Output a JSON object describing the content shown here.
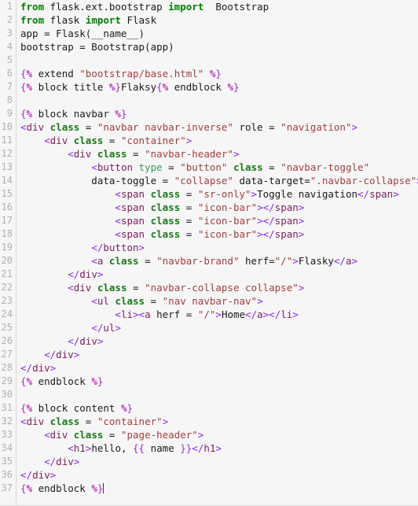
{
  "editor": {
    "background_color": "#f6f6f6",
    "gutter_color": "#b0b0b0",
    "total_lines": 37,
    "cursor_line": 37,
    "language": "Jinja2 / HTML / Python"
  },
  "colors": {
    "keyword": "#008000",
    "string": "#a14040",
    "tag_punct": "#8a2be2",
    "tag_name": "#7a1f5c",
    "attribute": "#1a7a1a",
    "jinja_brace": "#9b30c0",
    "jinja_percent": "#bb29bb",
    "plain_text": "#1a1a1a",
    "line_number": "#b0b0b0",
    "background": "#f6f6f6"
  },
  "gutter": {
    "numbers": [
      "1",
      "2",
      "3",
      "4",
      "5",
      "6",
      "7",
      "8",
      "9",
      "10",
      "11",
      "12",
      "13",
      "14",
      "15",
      "16",
      "17",
      "18",
      "19",
      "20",
      "21",
      "22",
      "23",
      "24",
      "25",
      "26",
      "27",
      "28",
      "29",
      "30",
      "31",
      "32",
      "33",
      "34",
      "35",
      "36",
      "37"
    ]
  },
  "lines": [
    {
      "n": 1,
      "text": "from flask.ext.bootstrap import  Bootstrap"
    },
    {
      "n": 2,
      "text": "from flask import Flask"
    },
    {
      "n": 3,
      "text": "app = Flask(__name__)"
    },
    {
      "n": 4,
      "text": "bootstrap = Bootstrap(app)"
    },
    {
      "n": 5,
      "text": ""
    },
    {
      "n": 6,
      "text": "{% extend \"bootstrap/base.html\" %}"
    },
    {
      "n": 7,
      "text": "{% block title %}Flaksy{% endblock %}"
    },
    {
      "n": 8,
      "text": ""
    },
    {
      "n": 9,
      "text": "{% block navbar %}"
    },
    {
      "n": 10,
      "text": "<div class = \"navbar navbar-inverse\" role = \"navigation\">"
    },
    {
      "n": 11,
      "text": "    <div class = \"container\">"
    },
    {
      "n": 12,
      "text": "        <div class = \"navbar-header\">"
    },
    {
      "n": 13,
      "text": "            <button type = \"button\" class = \"navbar-toggle\""
    },
    {
      "n": 14,
      "text": "            data-toggle = \"collapse\" data-target=\".navbar-collapse\">"
    },
    {
      "n": 15,
      "text": "                <span class = \"sr-only\">Toggle navigation</span>"
    },
    {
      "n": 16,
      "text": "                <span class = \"icon-bar\"></span>"
    },
    {
      "n": 17,
      "text": "                <span class = \"icon-bar\"></span>"
    },
    {
      "n": 18,
      "text": "                <span class = \"icon-bar\"></span>"
    },
    {
      "n": 19,
      "text": "            </button>"
    },
    {
      "n": 20,
      "text": "            <a class = \"navbar-brand\" herf=\"/\">Flasky</a>"
    },
    {
      "n": 21,
      "text": "        </div>"
    },
    {
      "n": 22,
      "text": "        <div class = \"navbar-collapse collapse\">"
    },
    {
      "n": 23,
      "text": "            <ul class = \"nav navbar-nav\">"
    },
    {
      "n": 24,
      "text": "                <li><a herf = \"/\">Home</a></li>"
    },
    {
      "n": 25,
      "text": "            </ul>"
    },
    {
      "n": 26,
      "text": "        </div>"
    },
    {
      "n": 27,
      "text": "    </div>"
    },
    {
      "n": 28,
      "text": "</div>"
    },
    {
      "n": 29,
      "text": "{% endblock %}"
    },
    {
      "n": 30,
      "text": ""
    },
    {
      "n": 31,
      "text": "{% block content %}"
    },
    {
      "n": 32,
      "text": "<div class = \"container\">"
    },
    {
      "n": 33,
      "text": "    <div class = \"page-header\">"
    },
    {
      "n": 34,
      "text": "        <h1>hello, {{ name }}</h1>"
    },
    {
      "n": 35,
      "text": "    </div>"
    },
    {
      "n": 36,
      "text": "</div>"
    },
    {
      "n": 37,
      "text": "{% endblock %}"
    }
  ],
  "tokens": [
    [
      {
        "t": "from",
        "c": "t-kw"
      },
      {
        "t": " flask.ext.bootstrap ",
        "c": "t-plain"
      },
      {
        "t": "import",
        "c": "t-kw"
      },
      {
        "t": "  Bootstrap",
        "c": "t-plain"
      }
    ],
    [
      {
        "t": "from",
        "c": "t-kw"
      },
      {
        "t": " flask ",
        "c": "t-plain"
      },
      {
        "t": "import",
        "c": "t-kw"
      },
      {
        "t": " Flask",
        "c": "t-plain"
      }
    ],
    [
      {
        "t": "app = Flask(__name__)",
        "c": "t-plain"
      }
    ],
    [
      {
        "t": "bootstrap = Bootstrap(app)",
        "c": "t-plain"
      }
    ],
    [],
    [
      {
        "t": "{",
        "c": "t-brace"
      },
      {
        "t": "%",
        "c": "t-pct"
      },
      {
        "t": " extend ",
        "c": "t-plain"
      },
      {
        "t": "\"bootstrap/base.html\"",
        "c": "t-str"
      },
      {
        "t": " ",
        "c": "t-plain"
      },
      {
        "t": "%",
        "c": "t-pct"
      },
      {
        "t": "}",
        "c": "t-brace"
      }
    ],
    [
      {
        "t": "{",
        "c": "t-brace"
      },
      {
        "t": "%",
        "c": "t-pct"
      },
      {
        "t": " block title ",
        "c": "t-plain"
      },
      {
        "t": "%",
        "c": "t-pct"
      },
      {
        "t": "}",
        "c": "t-brace"
      },
      {
        "t": "Flaksy",
        "c": "t-text"
      },
      {
        "t": "{",
        "c": "t-brace"
      },
      {
        "t": "%",
        "c": "t-pct"
      },
      {
        "t": " endblock ",
        "c": "t-plain"
      },
      {
        "t": "%",
        "c": "t-pct"
      },
      {
        "t": "}",
        "c": "t-brace"
      }
    ],
    [],
    [
      {
        "t": "{",
        "c": "t-brace"
      },
      {
        "t": "%",
        "c": "t-pct"
      },
      {
        "t": " block navbar ",
        "c": "t-plain"
      },
      {
        "t": "%",
        "c": "t-pct"
      },
      {
        "t": "}",
        "c": "t-brace"
      }
    ],
    [
      {
        "t": "<",
        "c": "t-punct"
      },
      {
        "t": "div",
        "c": "t-tag"
      },
      {
        "t": " ",
        "c": "t-plain"
      },
      {
        "t": "class",
        "c": "t-attr"
      },
      {
        "t": " = ",
        "c": "t-plain"
      },
      {
        "t": "\"navbar navbar-inverse\"",
        "c": "t-str"
      },
      {
        "t": " role = ",
        "c": "t-plain"
      },
      {
        "t": "\"navigation\"",
        "c": "t-str"
      },
      {
        "t": ">",
        "c": "t-punct"
      }
    ],
    [
      {
        "t": "    ",
        "c": "t-plain"
      },
      {
        "t": "<",
        "c": "t-punct"
      },
      {
        "t": "div",
        "c": "t-tag"
      },
      {
        "t": " ",
        "c": "t-plain"
      },
      {
        "t": "class",
        "c": "t-attr"
      },
      {
        "t": " = ",
        "c": "t-plain"
      },
      {
        "t": "\"container\"",
        "c": "t-str"
      },
      {
        "t": ">",
        "c": "t-punct"
      }
    ],
    [
      {
        "t": "        ",
        "c": "t-plain"
      },
      {
        "t": "<",
        "c": "t-punct"
      },
      {
        "t": "div",
        "c": "t-tag"
      },
      {
        "t": " ",
        "c": "t-plain"
      },
      {
        "t": "class",
        "c": "t-attr"
      },
      {
        "t": " = ",
        "c": "t-plain"
      },
      {
        "t": "\"navbar-header\"",
        "c": "t-str"
      },
      {
        "t": ">",
        "c": "t-punct"
      }
    ],
    [
      {
        "t": "            ",
        "c": "t-plain"
      },
      {
        "t": "<",
        "c": "t-punct"
      },
      {
        "t": "button",
        "c": "t-tag"
      },
      {
        "t": " ",
        "c": "t-plain"
      },
      {
        "t": "type",
        "c": "t-attr2"
      },
      {
        "t": " = ",
        "c": "t-plain"
      },
      {
        "t": "\"button\"",
        "c": "t-str"
      },
      {
        "t": " ",
        "c": "t-plain"
      },
      {
        "t": "class",
        "c": "t-attr"
      },
      {
        "t": " = ",
        "c": "t-plain"
      },
      {
        "t": "\"navbar-toggle\"",
        "c": "t-str"
      }
    ],
    [
      {
        "t": "            data-toggle = ",
        "c": "t-plain"
      },
      {
        "t": "\"collapse\"",
        "c": "t-str"
      },
      {
        "t": " data-target=",
        "c": "t-plain"
      },
      {
        "t": "\".navbar-collapse\"",
        "c": "t-str"
      },
      {
        "t": ">",
        "c": "t-punct"
      }
    ],
    [
      {
        "t": "                ",
        "c": "t-plain"
      },
      {
        "t": "<",
        "c": "t-punct"
      },
      {
        "t": "span",
        "c": "t-tag"
      },
      {
        "t": " ",
        "c": "t-plain"
      },
      {
        "t": "class",
        "c": "t-attr"
      },
      {
        "t": " = ",
        "c": "t-plain"
      },
      {
        "t": "\"sr-only\"",
        "c": "t-str"
      },
      {
        "t": ">",
        "c": "t-punct"
      },
      {
        "t": "Toggle navigation",
        "c": "t-text"
      },
      {
        "t": "</",
        "c": "t-punct"
      },
      {
        "t": "span",
        "c": "t-tag"
      },
      {
        "t": ">",
        "c": "t-punct"
      }
    ],
    [
      {
        "t": "                ",
        "c": "t-plain"
      },
      {
        "t": "<",
        "c": "t-punct"
      },
      {
        "t": "span",
        "c": "t-tag"
      },
      {
        "t": " ",
        "c": "t-plain"
      },
      {
        "t": "class",
        "c": "t-attr"
      },
      {
        "t": " = ",
        "c": "t-plain"
      },
      {
        "t": "\"icon-bar\"",
        "c": "t-str"
      },
      {
        "t": ">",
        "c": "t-punct"
      },
      {
        "t": "</",
        "c": "t-punct"
      },
      {
        "t": "span",
        "c": "t-tag"
      },
      {
        "t": ">",
        "c": "t-punct"
      }
    ],
    [
      {
        "t": "                ",
        "c": "t-plain"
      },
      {
        "t": "<",
        "c": "t-punct"
      },
      {
        "t": "span",
        "c": "t-tag"
      },
      {
        "t": " ",
        "c": "t-plain"
      },
      {
        "t": "class",
        "c": "t-attr"
      },
      {
        "t": " = ",
        "c": "t-plain"
      },
      {
        "t": "\"icon-bar\"",
        "c": "t-str"
      },
      {
        "t": ">",
        "c": "t-punct"
      },
      {
        "t": "</",
        "c": "t-punct"
      },
      {
        "t": "span",
        "c": "t-tag"
      },
      {
        "t": ">",
        "c": "t-punct"
      }
    ],
    [
      {
        "t": "                ",
        "c": "t-plain"
      },
      {
        "t": "<",
        "c": "t-punct"
      },
      {
        "t": "span",
        "c": "t-tag"
      },
      {
        "t": " ",
        "c": "t-plain"
      },
      {
        "t": "class",
        "c": "t-attr"
      },
      {
        "t": " = ",
        "c": "t-plain"
      },
      {
        "t": "\"icon-bar\"",
        "c": "t-str"
      },
      {
        "t": ">",
        "c": "t-punct"
      },
      {
        "t": "</",
        "c": "t-punct"
      },
      {
        "t": "span",
        "c": "t-tag"
      },
      {
        "t": ">",
        "c": "t-punct"
      }
    ],
    [
      {
        "t": "            ",
        "c": "t-plain"
      },
      {
        "t": "</",
        "c": "t-punct"
      },
      {
        "t": "button",
        "c": "t-tag"
      },
      {
        "t": ">",
        "c": "t-punct"
      }
    ],
    [
      {
        "t": "            ",
        "c": "t-plain"
      },
      {
        "t": "<",
        "c": "t-punct"
      },
      {
        "t": "a",
        "c": "t-tag"
      },
      {
        "t": " ",
        "c": "t-plain"
      },
      {
        "t": "class",
        "c": "t-attr"
      },
      {
        "t": " = ",
        "c": "t-plain"
      },
      {
        "t": "\"navbar-brand\"",
        "c": "t-str"
      },
      {
        "t": " herf=",
        "c": "t-plain"
      },
      {
        "t": "\"/\"",
        "c": "t-str"
      },
      {
        "t": ">",
        "c": "t-punct"
      },
      {
        "t": "Flasky",
        "c": "t-text"
      },
      {
        "t": "</",
        "c": "t-punct"
      },
      {
        "t": "a",
        "c": "t-tag"
      },
      {
        "t": ">",
        "c": "t-punct"
      }
    ],
    [
      {
        "t": "        ",
        "c": "t-plain"
      },
      {
        "t": "</",
        "c": "t-punct"
      },
      {
        "t": "div",
        "c": "t-tag"
      },
      {
        "t": ">",
        "c": "t-punct"
      }
    ],
    [
      {
        "t": "        ",
        "c": "t-plain"
      },
      {
        "t": "<",
        "c": "t-punct"
      },
      {
        "t": "div",
        "c": "t-tag"
      },
      {
        "t": " ",
        "c": "t-plain"
      },
      {
        "t": "class",
        "c": "t-attr"
      },
      {
        "t": " = ",
        "c": "t-plain"
      },
      {
        "t": "\"navbar-collapse collapse\"",
        "c": "t-str"
      },
      {
        "t": ">",
        "c": "t-punct"
      }
    ],
    [
      {
        "t": "            ",
        "c": "t-plain"
      },
      {
        "t": "<",
        "c": "t-punct"
      },
      {
        "t": "ul",
        "c": "t-tag"
      },
      {
        "t": " ",
        "c": "t-plain"
      },
      {
        "t": "class",
        "c": "t-attr"
      },
      {
        "t": " = ",
        "c": "t-plain"
      },
      {
        "t": "\"nav navbar-nav\"",
        "c": "t-str"
      },
      {
        "t": ">",
        "c": "t-punct"
      }
    ],
    [
      {
        "t": "                ",
        "c": "t-plain"
      },
      {
        "t": "<",
        "c": "t-punct"
      },
      {
        "t": "li",
        "c": "t-tag"
      },
      {
        "t": ">",
        "c": "t-punct"
      },
      {
        "t": "<",
        "c": "t-punct"
      },
      {
        "t": "a",
        "c": "t-tag"
      },
      {
        "t": " herf = ",
        "c": "t-plain"
      },
      {
        "t": "\"/\"",
        "c": "t-str"
      },
      {
        "t": ">",
        "c": "t-punct"
      },
      {
        "t": "Home",
        "c": "t-text"
      },
      {
        "t": "</",
        "c": "t-punct"
      },
      {
        "t": "a",
        "c": "t-tag"
      },
      {
        "t": ">",
        "c": "t-punct"
      },
      {
        "t": "</",
        "c": "t-punct"
      },
      {
        "t": "li",
        "c": "t-tag"
      },
      {
        "t": ">",
        "c": "t-punct"
      }
    ],
    [
      {
        "t": "            ",
        "c": "t-plain"
      },
      {
        "t": "</",
        "c": "t-punct"
      },
      {
        "t": "ul",
        "c": "t-tag"
      },
      {
        "t": ">",
        "c": "t-punct"
      }
    ],
    [
      {
        "t": "        ",
        "c": "t-plain"
      },
      {
        "t": "</",
        "c": "t-punct"
      },
      {
        "t": "div",
        "c": "t-tag"
      },
      {
        "t": ">",
        "c": "t-punct"
      }
    ],
    [
      {
        "t": "    ",
        "c": "t-plain"
      },
      {
        "t": "</",
        "c": "t-punct"
      },
      {
        "t": "div",
        "c": "t-tag"
      },
      {
        "t": ">",
        "c": "t-punct"
      }
    ],
    [
      {
        "t": "</",
        "c": "t-punct"
      },
      {
        "t": "div",
        "c": "t-tag"
      },
      {
        "t": ">",
        "c": "t-punct"
      }
    ],
    [
      {
        "t": "{",
        "c": "t-brace"
      },
      {
        "t": "%",
        "c": "t-pct"
      },
      {
        "t": " endblock ",
        "c": "t-plain"
      },
      {
        "t": "%",
        "c": "t-pct"
      },
      {
        "t": "}",
        "c": "t-brace"
      }
    ],
    [],
    [
      {
        "t": "{",
        "c": "t-brace"
      },
      {
        "t": "%",
        "c": "t-pct"
      },
      {
        "t": " block content ",
        "c": "t-plain"
      },
      {
        "t": "%",
        "c": "t-pct"
      },
      {
        "t": "}",
        "c": "t-brace"
      }
    ],
    [
      {
        "t": "<",
        "c": "t-punct"
      },
      {
        "t": "div",
        "c": "t-tag"
      },
      {
        "t": " ",
        "c": "t-plain"
      },
      {
        "t": "class",
        "c": "t-attr"
      },
      {
        "t": " = ",
        "c": "t-plain"
      },
      {
        "t": "\"container\"",
        "c": "t-str"
      },
      {
        "t": ">",
        "c": "t-punct"
      }
    ],
    [
      {
        "t": "    ",
        "c": "t-plain"
      },
      {
        "t": "<",
        "c": "t-punct"
      },
      {
        "t": "div",
        "c": "t-tag"
      },
      {
        "t": " ",
        "c": "t-plain"
      },
      {
        "t": "class",
        "c": "t-attr"
      },
      {
        "t": " = ",
        "c": "t-plain"
      },
      {
        "t": "\"page-header\"",
        "c": "t-str"
      },
      {
        "t": ">",
        "c": "t-punct"
      }
    ],
    [
      {
        "t": "        ",
        "c": "t-plain"
      },
      {
        "t": "<",
        "c": "t-punct"
      },
      {
        "t": "h1",
        "c": "t-tag"
      },
      {
        "t": ">",
        "c": "t-punct"
      },
      {
        "t": "hello, ",
        "c": "t-text"
      },
      {
        "t": "{{",
        "c": "t-brace"
      },
      {
        "t": " name ",
        "c": "t-plain"
      },
      {
        "t": "}}",
        "c": "t-brace"
      },
      {
        "t": "</",
        "c": "t-punct"
      },
      {
        "t": "h1",
        "c": "t-tag"
      },
      {
        "t": ">",
        "c": "t-punct"
      }
    ],
    [
      {
        "t": "    ",
        "c": "t-plain"
      },
      {
        "t": "</",
        "c": "t-punct"
      },
      {
        "t": "div",
        "c": "t-tag"
      },
      {
        "t": ">",
        "c": "t-punct"
      }
    ],
    [
      {
        "t": "</",
        "c": "t-punct"
      },
      {
        "t": "div",
        "c": "t-tag"
      },
      {
        "t": ">",
        "c": "t-punct"
      }
    ],
    [
      {
        "t": "{",
        "c": "t-brace"
      },
      {
        "t": "%",
        "c": "t-pct"
      },
      {
        "t": " endblock ",
        "c": "t-plain"
      },
      {
        "t": "%",
        "c": "t-pct"
      },
      {
        "t": "}",
        "c": "t-brace"
      }
    ]
  ]
}
